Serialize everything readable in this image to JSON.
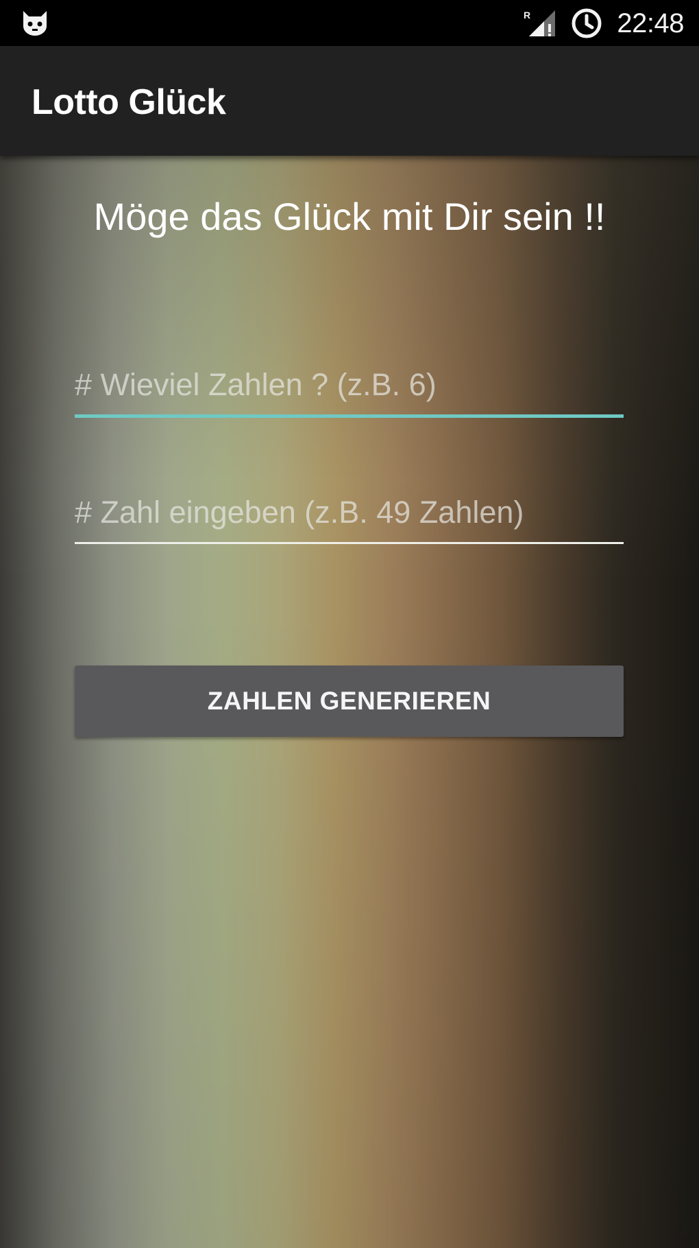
{
  "status_bar": {
    "left_icon": "cat-notification-icon",
    "signal_icon": "cellular-signal-icon",
    "alarm_icon": "alarm-clock-icon",
    "time": "22:48"
  },
  "app_bar": {
    "title": "Lotto Glück"
  },
  "main": {
    "greeting": "Möge das Glück mit Dir sein !!",
    "count_field": {
      "placeholder": "# Wieviel Zahlen ? (z.B. 6)",
      "value": ""
    },
    "range_field": {
      "placeholder": "# Zahl eingeben (z.B. 49 Zahlen)",
      "value": ""
    },
    "generate_button_label": "ZAHLEN GENERIEREN"
  },
  "colors": {
    "app_bar": "#212121",
    "focused_underline": "#6fc9c4",
    "button": "#59595b"
  }
}
